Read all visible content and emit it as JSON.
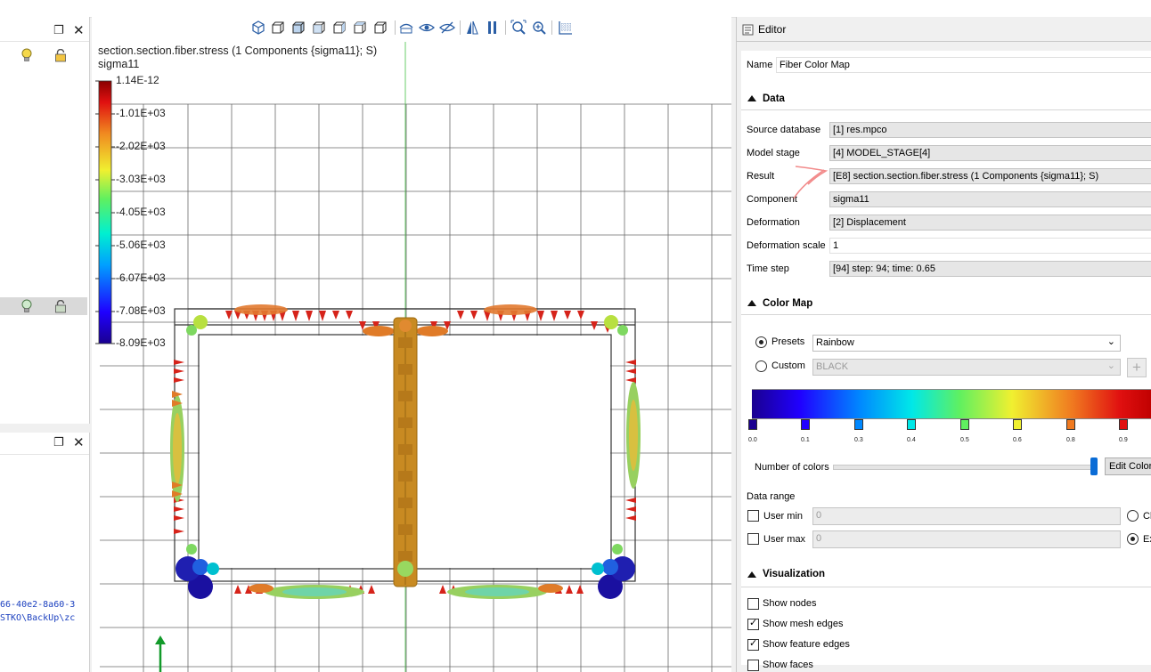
{
  "left_panel": {
    "restore_icon": "restore-icon",
    "close_icon": "close-icon",
    "log_lines": [
      "66-40e2-8a60-3",
      "STKO\\BackUp\\zc"
    ]
  },
  "viewport": {
    "legend_title": "section.section.fiber.stress (1 Components {sigma11}; S)",
    "legend_subtitle": "sigma11",
    "legend_ticks": [
      "1.14E-12",
      "-1.01E+03",
      "-2.02E+03",
      "-3.03E+03",
      "-4.05E+03",
      "-5.06E+03",
      "-6.07E+03",
      "-7.08E+03",
      "-8.09E+03"
    ]
  },
  "editor": {
    "title": "Editor",
    "name_label": "Name",
    "name_value": "Fiber Color Map",
    "data_section": "Data",
    "fields": [
      {
        "label": "Source database",
        "value": "[1] res.mpco"
      },
      {
        "label": "Model stage",
        "value": "[4] MODEL_STAGE[4]"
      },
      {
        "label": "Result",
        "value": "[E8] section.section.fiber.stress (1 Components {sigma11}; S)"
      },
      {
        "label": "Component",
        "value": "sigma11"
      },
      {
        "label": "Deformation",
        "value": "[2] Displacement"
      },
      {
        "label": "Deformation scale",
        "value": "1"
      },
      {
        "label": "Time step",
        "value": "[94] step: 94; time: 0.65"
      }
    ],
    "color_map_section": "Color Map",
    "presets_label": "Presets",
    "presets_value": "Rainbow",
    "custom_label": "Custom",
    "custom_value": "BLACK",
    "gradient_ticks": [
      "0.0",
      "0.1",
      "0.3",
      "0.4",
      "0.5",
      "0.6",
      "0.8",
      "0.9"
    ],
    "number_of_colors_label": "Number of colors",
    "edit_color_label": "Edit Color",
    "data_range_label": "Data range",
    "user_min_label": "User min",
    "user_min_value": "0",
    "user_max_label": "User max",
    "user_max_value": "0",
    "right_radio_1": "Cl",
    "right_radio_2": "Ex",
    "visualization_section": "Visualization",
    "vis_options": [
      {
        "label": "Show nodes",
        "checked": false
      },
      {
        "label": "Show mesh edges",
        "checked": true
      },
      {
        "label": "Show feature edges",
        "checked": true
      },
      {
        "label": "Show faces",
        "checked": false
      }
    ]
  },
  "colors": {
    "accent": "#0a6cd6",
    "annotation_arrow": "#f28a8a",
    "axis_green": "#129a2a"
  }
}
